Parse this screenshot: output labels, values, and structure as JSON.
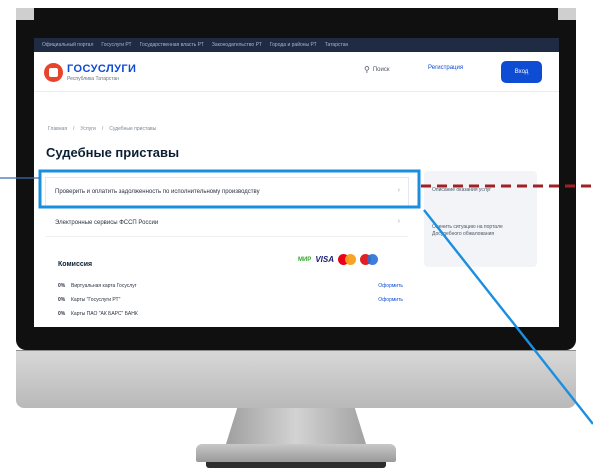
{
  "top_links": [
    "Официальный портал",
    "Госуслуги РТ",
    "Государственная власть РТ",
    "Законодательство РТ",
    "Города и районы РТ",
    "Татарстан"
  ],
  "header": {
    "logo_title": "ГОСУСЛУГИ",
    "logo_subtitle": "Республика Татарстан",
    "search_label": "Поиск",
    "register_label": "Регистрация",
    "login_label": "Вход"
  },
  "breadcrumb": [
    "Главная",
    "Услуги",
    "Судебные приставы"
  ],
  "page_title": "Судебные приставы",
  "services": [
    "Проверить и оплатить задолженность по исполнительному производству",
    "Электронные сервисы ФССП России"
  ],
  "fees": {
    "title": "Комиссия",
    "payment_logos": {
      "mir": "МИР",
      "visa": "VISA"
    },
    "rows": [
      {
        "pct": "0%",
        "name": "Виртуальная карта Госуслуг",
        "link": "Оформить"
      },
      {
        "pct": "0%",
        "name": "Карты \"Госуслуги РТ\"",
        "link": "Оформить"
      },
      {
        "pct": "0%",
        "name": "Карты ПАО \"АК БАРС\" БАНК",
        "link": ""
      }
    ]
  },
  "sidebar": {
    "items": [
      "Описание оказания услуг",
      "Оценить ситуацию на портале Досудебного обжалования"
    ]
  },
  "colors": {
    "accent": "#0d4cd3",
    "highlight": "#1a8fe0",
    "annotation_dash": "#a31f26",
    "topbar": "#1f2b43"
  }
}
